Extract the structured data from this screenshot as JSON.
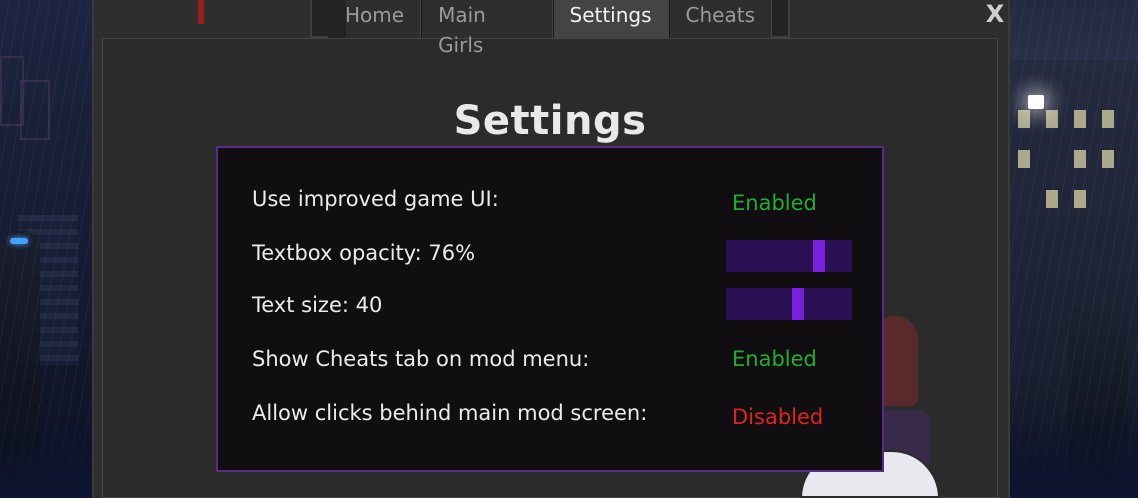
{
  "window": {
    "close_label": "X"
  },
  "tabs": [
    {
      "label": "Home",
      "active": false
    },
    {
      "label": "Main Girls",
      "active": false
    },
    {
      "label": "Settings",
      "active": true
    },
    {
      "label": "Cheats",
      "active": false
    }
  ],
  "page_title": "Settings",
  "settings": {
    "improved_ui": {
      "label": "Use improved game UI:",
      "value": "Enabled",
      "state": "on"
    },
    "textbox_opacity": {
      "label": "Textbox opacity: 76%",
      "level": 0.76
    },
    "text_size": {
      "label": "Text size: 40",
      "level": 0.58
    },
    "show_cheats_tab": {
      "label": "Show Cheats tab on mod menu:",
      "value": "Enabled",
      "state": "on"
    },
    "allow_clicks_behind": {
      "label": "Allow clicks behind main mod screen:",
      "value": "Disabled",
      "state": "off"
    }
  },
  "colors": {
    "enabled": "#1fae2e",
    "disabled": "#e0231c",
    "slider_track": "#2b0f55",
    "slider_thumb": "#7a1ee0",
    "box_border": "#5a2a8a"
  }
}
